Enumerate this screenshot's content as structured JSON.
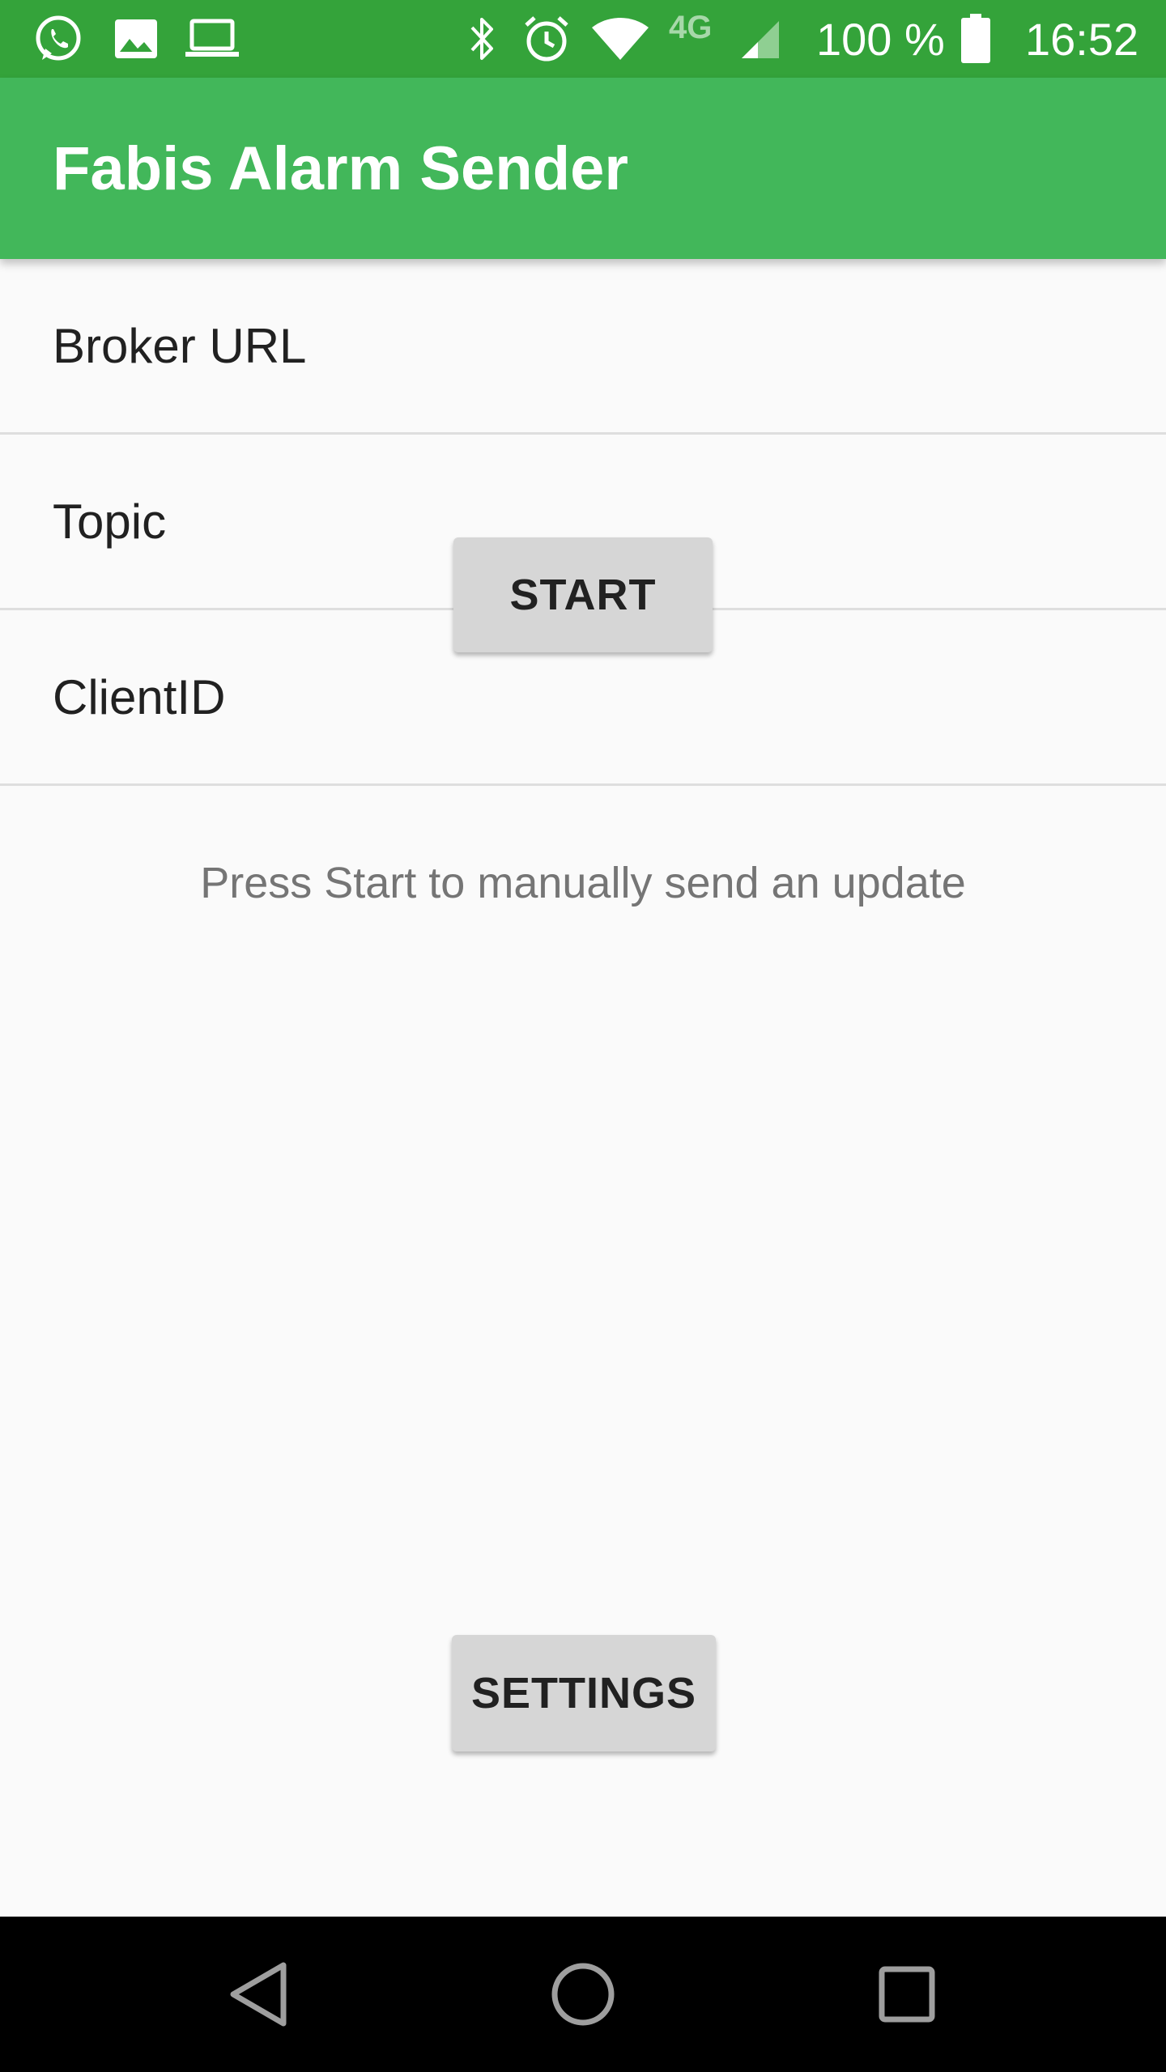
{
  "status_bar": {
    "left_icons": [
      "whatsapp-icon",
      "image-icon",
      "laptop-icon"
    ],
    "right_icons": [
      "bluetooth-icon",
      "alarm-icon",
      "wifi-icon",
      "signal-icon",
      "battery-icon"
    ],
    "network_type": "4G",
    "battery": "100 %",
    "time": "16:52"
  },
  "app_bar": {
    "title": "Fabis Alarm Sender"
  },
  "fields": [
    {
      "label": "Broker URL"
    },
    {
      "label": "Topic"
    },
    {
      "label": "ClientID"
    }
  ],
  "buttons": {
    "start": "START",
    "settings": "SETTINGS"
  },
  "hint": "Press Start to manually send an update",
  "nav_bar": {
    "items": [
      "back-icon",
      "home-icon",
      "recents-icon"
    ]
  },
  "colors": {
    "status_bar": "#34a33a",
    "app_bar": "#42b75a",
    "background": "#fafafa",
    "button": "#d6d6d6",
    "nav_bar": "#000000"
  }
}
